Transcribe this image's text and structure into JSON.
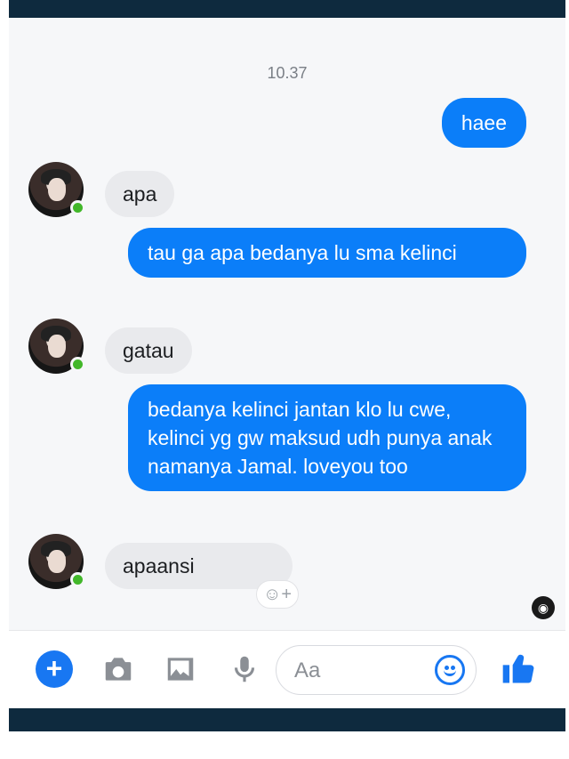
{
  "chat": {
    "timestamp": "10.37",
    "messages": [
      {
        "from": "me",
        "text": "haee"
      },
      {
        "from": "them",
        "text": "apa"
      },
      {
        "from": "me",
        "text": "tau ga apa bedanya lu sma kelinci"
      },
      {
        "from": "them",
        "text": "gatau"
      },
      {
        "from": "me",
        "text": "bedanya kelinci jantan klo lu cwe, kelinci yg gw maksud udh punya anak namanya Jamal.  loveyou too"
      },
      {
        "from": "them",
        "text": "apaansi"
      }
    ],
    "reaction_icon": "smiley-plus-icon",
    "seen_icon": "seen-avatar-icon"
  },
  "composer": {
    "placeholder": "Aa",
    "icons": [
      "plus-icon",
      "camera-icon",
      "image-icon",
      "mic-icon",
      "emoji-icon",
      "thumbs-up-icon"
    ]
  },
  "colors": {
    "outgoing_bubble": "#0b7ef9",
    "incoming_bubble": "#e9eaed",
    "online_dot": "#42b72a",
    "accent": "#1877f2",
    "frame": "#0e2a3e"
  }
}
